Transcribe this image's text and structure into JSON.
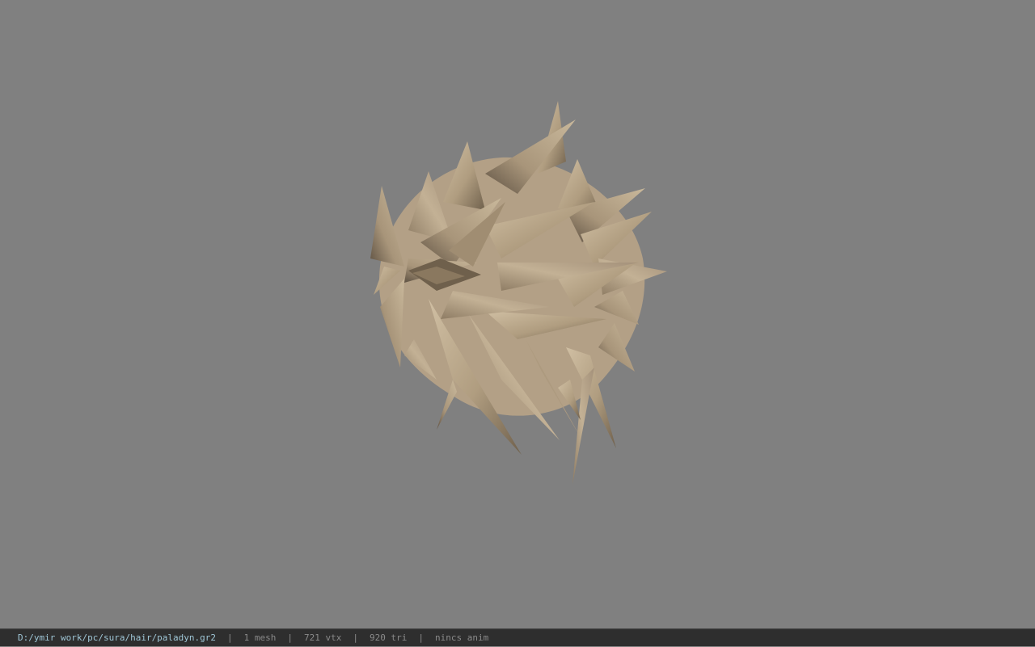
{
  "viewport": {
    "background_color": "#808080",
    "model": {
      "description_icon": "hair-mesh",
      "base_color": "#b9a78c",
      "shadow_color": "#6e5f4c",
      "highlight_color": "#d3c2a6"
    }
  },
  "status_bar": {
    "file_path": "D:/ymir work/pc/sura/hair/paladyn.gr2",
    "separator": "|",
    "mesh_count": "1 mesh",
    "vertex_count": "721 vtx",
    "triangle_count": "920 tri",
    "anim_status": "nincs anim",
    "path_color": "#9fc6d6",
    "text_color": "#8a8a8a"
  }
}
